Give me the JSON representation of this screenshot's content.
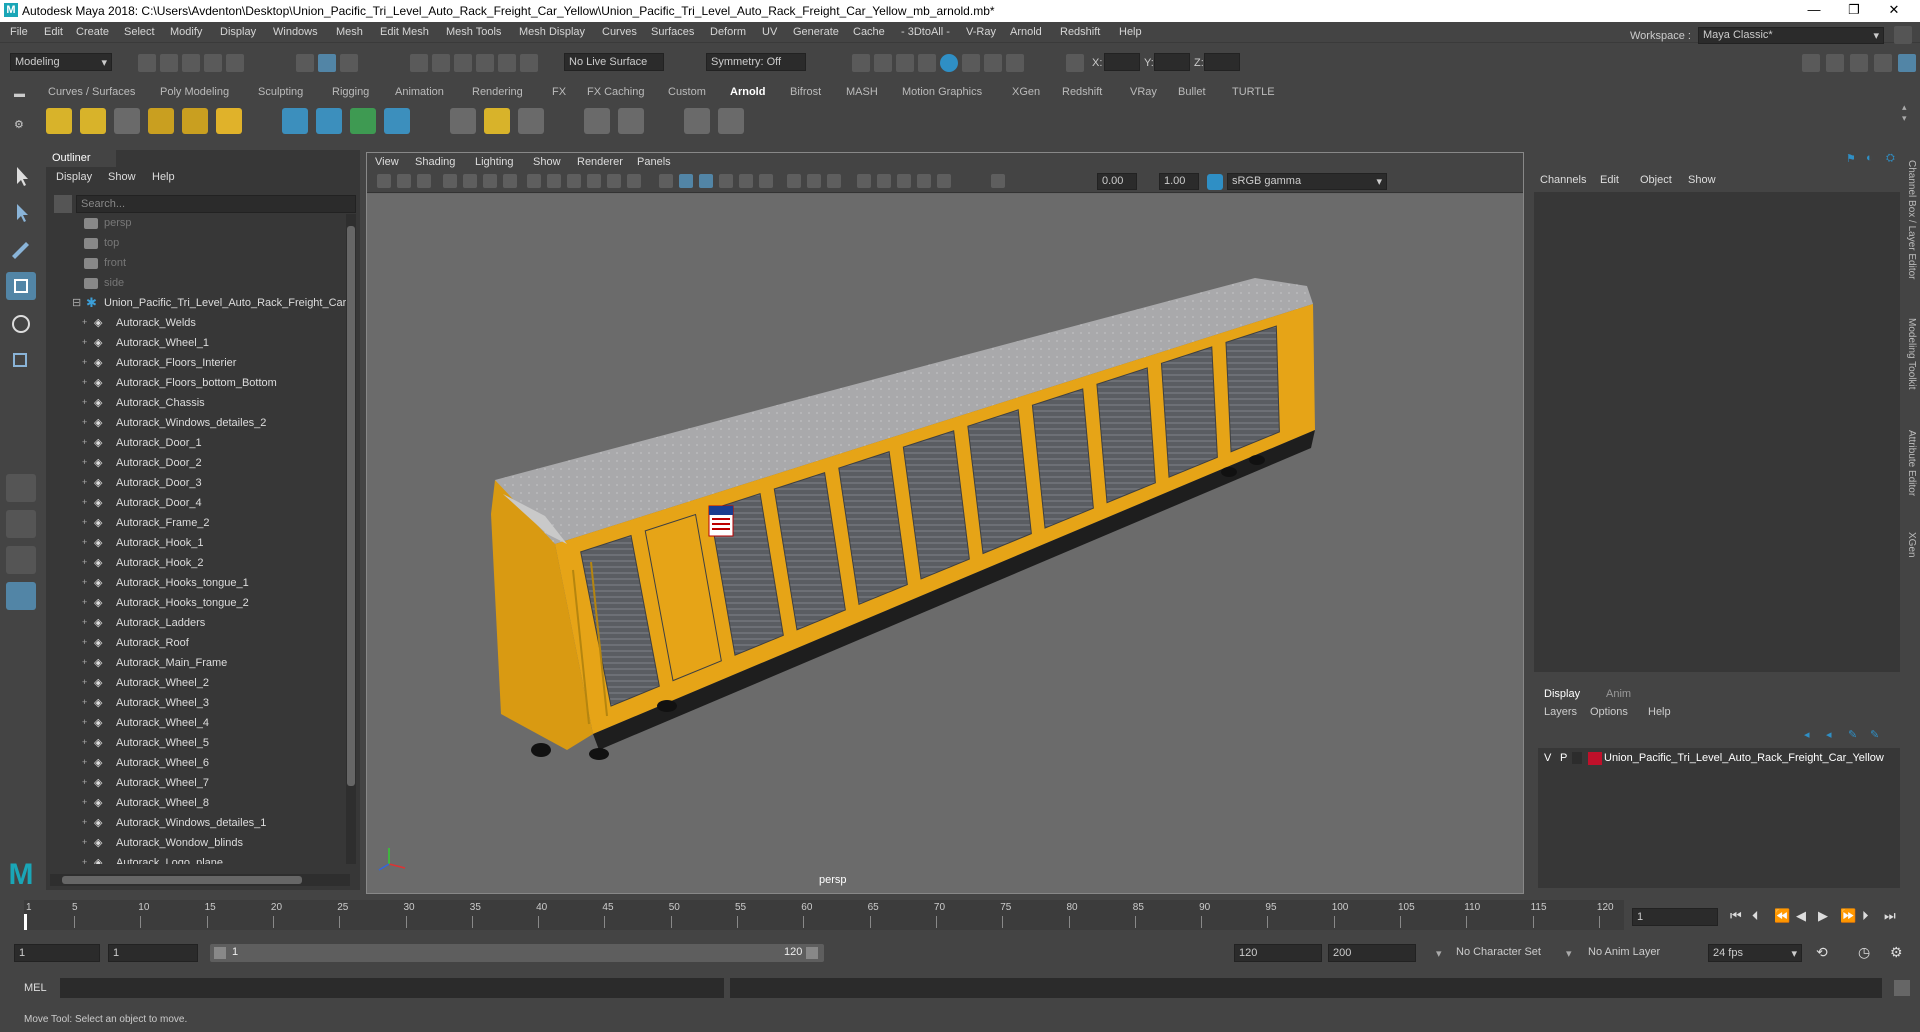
{
  "titlebar": {
    "title": "Autodesk Maya 2018: C:\\Users\\Avdenton\\Desktop\\Union_Pacific_Tri_Level_Auto_Rack_Freight_Car_Yellow\\Union_Pacific_Tri_Level_Auto_Rack_Freight_Car_Yellow_mb_arnold.mb*",
    "minimize": "—",
    "maximize": "❐",
    "close": "✕"
  },
  "menubar": [
    "File",
    "Edit",
    "Create",
    "Select",
    "Modify",
    "Display",
    "Windows",
    "Mesh",
    "Edit Mesh",
    "Mesh Tools",
    "Mesh Display",
    "Curves",
    "Surfaces",
    "Deform",
    "UV",
    "Generate",
    "Cache",
    "- 3DtoAll -",
    "V-Ray",
    "Arnold",
    "Redshift",
    "Help"
  ],
  "statusline": {
    "mode": "Modeling",
    "live_surface": "No Live Surface",
    "symmetry": "Symmetry: Off",
    "x_label": "X:",
    "y_label": "Y:",
    "z_label": "Z:",
    "workspace_label": "Workspace :",
    "workspace_value": "Maya Classic*"
  },
  "shelf_tabs": [
    "Curves / Surfaces",
    "Poly Modeling",
    "Sculpting",
    "Rigging",
    "Animation",
    "Rendering",
    "FX",
    "FX Caching",
    "Custom",
    "Arnold",
    "Bifrost",
    "MASH",
    "Motion Graphics",
    "XGen",
    "Redshift",
    "VRay",
    "Bullet",
    "TURTLE"
  ],
  "shelf_active_tab": "Arnold",
  "outliner": {
    "title": "Outliner",
    "menu": [
      "Display",
      "Show",
      "Help"
    ],
    "search_placeholder": "Search...",
    "cameras": [
      "persp",
      "top",
      "front",
      "side"
    ],
    "group": "Union_Pacific_Tri_Level_Auto_Rack_Freight_Car_",
    "items": [
      "Autorack_Welds",
      "Autorack_Wheel_1",
      "Autorack_Floors_Interier",
      "Autorack_Floors_bottom_Bottom",
      "Autorack_Chassis",
      "Autorack_Windows_detailes_2",
      "Autorack_Door_1",
      "Autorack_Door_2",
      "Autorack_Door_3",
      "Autorack_Door_4",
      "Autorack_Frame_2",
      "Autorack_Hook_1",
      "Autorack_Hook_2",
      "Autorack_Hooks_tongue_1",
      "Autorack_Hooks_tongue_2",
      "Autorack_Ladders",
      "Autorack_Roof",
      "Autorack_Main_Frame",
      "Autorack_Wheel_2",
      "Autorack_Wheel_3",
      "Autorack_Wheel_4",
      "Autorack_Wheel_5",
      "Autorack_Wheel_6",
      "Autorack_Wheel_7",
      "Autorack_Wheel_8",
      "Autorack_Windows_detailes_1",
      "Autorack_Wondow_blinds",
      "Autorack_Logo_plane"
    ]
  },
  "viewport": {
    "menu": [
      "View",
      "Shading",
      "Lighting",
      "Show",
      "Renderer",
      "Panels"
    ],
    "near_value": "0.00",
    "far_value": "1.00",
    "color_space": "sRGB gamma",
    "camera_label": "persp"
  },
  "channelbox": {
    "menu": [
      "Channels",
      "Edit",
      "Object",
      "Show"
    ],
    "side_tabs": [
      "Channel Box / Layer Editor",
      "Modeling Toolkit",
      "Attribute Editor",
      "XGen"
    ]
  },
  "layers": {
    "tabs": [
      "Display",
      "Anim"
    ],
    "menu": [
      "Layers",
      "Options",
      "Help"
    ],
    "row": {
      "v": "V",
      "p": "P",
      "name": "Union_Pacific_Tri_Level_Auto_Rack_Freight_Car_Yellow",
      "color": "#c0102a"
    }
  },
  "timeline": {
    "ticks": [
      "5",
      "10",
      "15",
      "20",
      "25",
      "30",
      "35",
      "40",
      "45",
      "50",
      "55",
      "60",
      "65",
      "70",
      "75",
      "80",
      "85",
      "90",
      "95",
      "100",
      "105",
      "110",
      "115",
      "120"
    ],
    "start_tick": "1",
    "current_frame": "1"
  },
  "range": {
    "start": "1",
    "start_inner": "1",
    "range_start": "1",
    "range_end": "120",
    "end_inner": "120",
    "end": "200",
    "character_set": "No Character Set",
    "anim_layer": "No Anim Layer",
    "fps": "24 fps"
  },
  "cmdline": {
    "label": "MEL"
  },
  "helpline": {
    "text": "Move Tool: Select an object to move."
  },
  "colors": {
    "accent": "#5285a6",
    "car_yellow": "#e6a417",
    "roof": "#a9a9ab"
  }
}
